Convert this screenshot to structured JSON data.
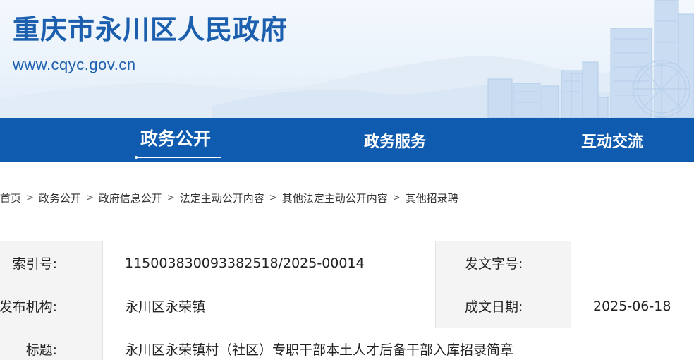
{
  "header": {
    "title": "重庆市永川区人民政府",
    "url": "www.cqyc.gov.cn"
  },
  "colors": {
    "brand_blue": "#1b5fae",
    "nav_blue": "#0f5bb0"
  },
  "nav": {
    "items": [
      {
        "label": "政务公开",
        "active": true
      },
      {
        "label": "政务服务",
        "active": false
      },
      {
        "label": "互动交流",
        "active": false
      }
    ]
  },
  "breadcrumb": {
    "items": [
      "首页",
      "政务公开",
      "政府信息公开",
      "法定主动公开内容",
      "其他法定主动公开内容",
      "其他招录聘"
    ],
    "separator": ">"
  },
  "info": {
    "index_label": "索引号:",
    "index_value": "115003830093382518/2025-00014",
    "doc_no_label": "发文字号:",
    "doc_no_value": "",
    "publisher_label": "发布机构:",
    "publisher_value": "永川区永荣镇",
    "date_label": "成文日期:",
    "date_value": "2025-06-18",
    "title_label": "标题:",
    "title_value": "永川区永荣镇村（社区）专职干部本土人才后备干部入库招录简章"
  }
}
